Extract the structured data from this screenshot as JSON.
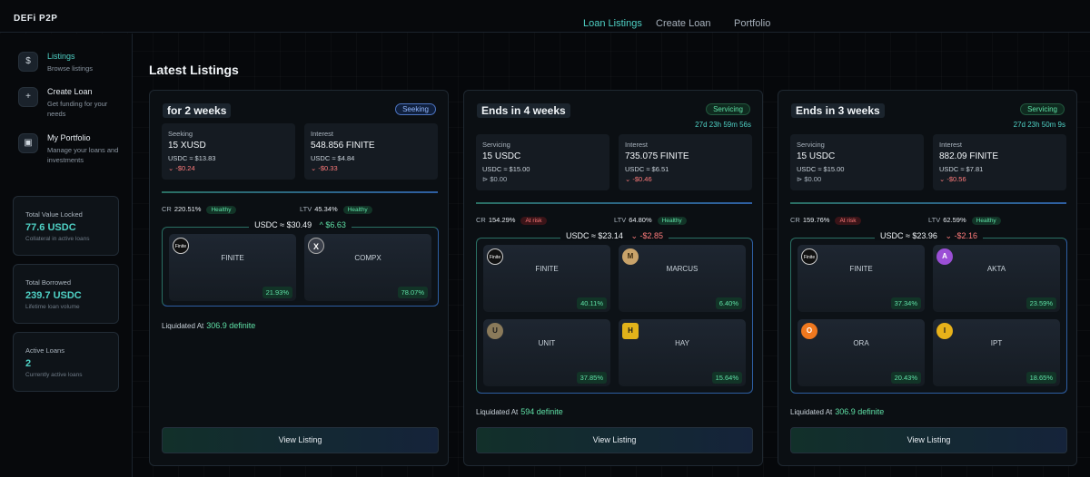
{
  "app": {
    "logo": "DEFi P2P"
  },
  "nav": {
    "listings": "Loan Listings",
    "create": "Create Loan",
    "portfolio": "Portfolio"
  },
  "sidebar": {
    "items": [
      {
        "icon": "$",
        "title": "Listings",
        "sub": "Browse listings"
      },
      {
        "icon": "+",
        "title": "Create Loan",
        "sub": "Get funding for your needs"
      },
      {
        "icon": "▣",
        "title": "My Portfolio",
        "sub": "Manage your loans and investments"
      }
    ],
    "stats": [
      {
        "label": "Total Value Locked",
        "value": "77.6 USDC",
        "sub": "Collateral in active loans"
      },
      {
        "label": "Total Borrowed",
        "value": "239.7 USDC",
        "sub": "Lifetime loan volume"
      },
      {
        "label": "Active Loans",
        "value": "2",
        "sub": "Currently active loans"
      }
    ]
  },
  "heading": "Latest Listings",
  "cards": [
    {
      "title": "for 2 weeks",
      "badge": "Seeking",
      "countdown": "",
      "left_box": {
        "label": "Seeking",
        "value": "15 XUSD",
        "usd": "USDC ≈ $13.83",
        "delta": "⌄ -$0.24"
      },
      "right_box": {
        "label": "Interest",
        "value": "548.856 FINITE",
        "usd": "USDC ≈ $4.84",
        "delta": "⌄ -$0.33"
      },
      "cr_label": "CR",
      "cr": "220.51%",
      "cr_status": "Healthy",
      "ltv_label": "LTV",
      "ltv": "45.34%",
      "ltv_status": "Healthy",
      "collateral": {
        "value": "USDC ≈ $30.49",
        "change": "^  $6.63"
      },
      "tokens": [
        {
          "name": "FINITE",
          "pct": "21.93%",
          "icon": "Finite"
        },
        {
          "name": "COMPX",
          "pct": "78.07%",
          "icon": "X"
        }
      ],
      "liq_label": "Liquidated At",
      "liq_value": "306.9 definite",
      "button": "View Listing"
    },
    {
      "title": "Ends in 4 weeks",
      "badge": "Servicing",
      "countdown": "27d 23h 59m 56s",
      "left_box": {
        "label": "Servicing",
        "value": "15 USDC",
        "usd": "USDC ≈ $15.00",
        "delta": "⊳ $0.00"
      },
      "right_box": {
        "label": "Interest",
        "value": "735.075 FINITE",
        "usd": "USDC ≈ $6.51",
        "delta": "⌄ -$0.46"
      },
      "cr_label": "CR",
      "cr": "154.29%",
      "cr_status": "At risk",
      "ltv_label": "LTV",
      "ltv": "64.80%",
      "ltv_status": "Healthy",
      "collateral": {
        "value": "USDC ≈ $23.14",
        "change": "⌄  -$2.85"
      },
      "tokens": [
        {
          "name": "FINITE",
          "pct": "40.11%",
          "icon": "Finite"
        },
        {
          "name": "MARCUS",
          "pct": "6.40%",
          "icon": "M"
        },
        {
          "name": "UNIT",
          "pct": "37.85%",
          "icon": "U"
        },
        {
          "name": "HAY",
          "pct": "15.64%",
          "icon": "H"
        }
      ],
      "liq_label": "Liquidated At",
      "liq_value": "594 definite",
      "button": "View Listing"
    },
    {
      "title": "Ends in 3 weeks",
      "badge": "Servicing",
      "countdown": "27d 23h 50m 9s",
      "left_box": {
        "label": "Servicing",
        "value": "15 USDC",
        "usd": "USDC ≈ $15.00",
        "delta": "⊳ $0.00"
      },
      "right_box": {
        "label": "Interest",
        "value": "882.09 FINITE",
        "usd": "USDC ≈ $7.81",
        "delta": "⌄ -$0.56"
      },
      "cr_label": "CR",
      "cr": "159.76%",
      "cr_status": "At risk",
      "ltv_label": "LTV",
      "ltv": "62.59%",
      "ltv_status": "Healthy",
      "collateral": {
        "value": "USDC ≈ $23.96",
        "change": "⌄  -$2.16"
      },
      "tokens": [
        {
          "name": "FINITE",
          "pct": "37.34%",
          "icon": "Finite"
        },
        {
          "name": "AKTA",
          "pct": "23.59%",
          "icon": "A"
        },
        {
          "name": "ORA",
          "pct": "20.43%",
          "icon": "O"
        },
        {
          "name": "IPT",
          "pct": "18.65%",
          "icon": "I"
        }
      ],
      "liq_label": "Liquidated At",
      "liq_value": "306.9 definite",
      "button": "View Listing"
    }
  ]
}
